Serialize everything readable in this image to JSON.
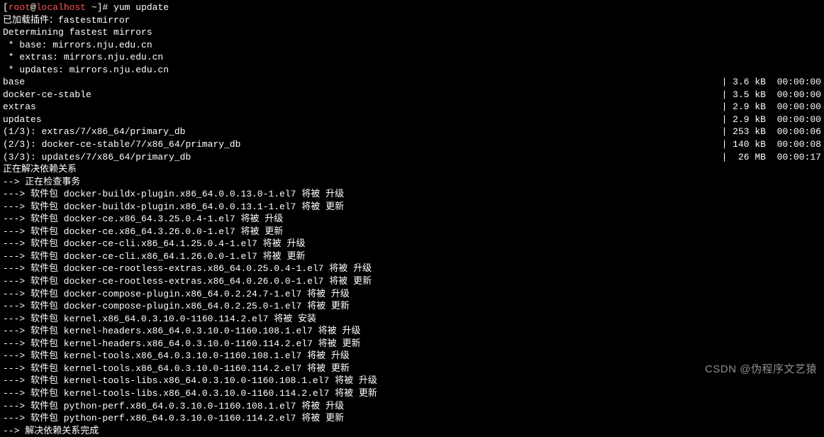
{
  "prompt": {
    "lbracket": "[",
    "user": "root",
    "at": "@",
    "host": "localhost",
    "path": " ~",
    "rbracket": "]# ",
    "command": "yum update"
  },
  "header_lines": [
    "已加载插件：fastestmirror",
    "Determining fastest mirrors",
    " * base: mirrors.nju.edu.cn",
    " * extras: mirrors.nju.edu.cn",
    " * updates: mirrors.nju.edu.cn"
  ],
  "repo_rows": [
    {
      "left": "base",
      "right": "| 3.6 kB  00:00:00"
    },
    {
      "left": "docker-ce-stable",
      "right": "| 3.5 kB  00:00:00"
    },
    {
      "left": "extras",
      "right": "| 2.9 kB  00:00:00"
    },
    {
      "left": "updates",
      "right": "| 2.9 kB  00:00:00"
    },
    {
      "left": "(1/3): extras/7/x86_64/primary_db",
      "right": "| 253 kB  00:00:06"
    },
    {
      "left": "(2/3): docker-ce-stable/7/x86_64/primary_db",
      "right": "| 140 kB  00:00:08"
    },
    {
      "left": "(3/3): updates/7/x86_64/primary_db",
      "right": "|  26 MB  00:00:17"
    }
  ],
  "resolve_lines": [
    "正在解决依赖关系",
    "--> 正在检查事务",
    "---> 软件包 docker-buildx-plugin.x86_64.0.0.13.0-1.el7 将被 升级",
    "---> 软件包 docker-buildx-plugin.x86_64.0.0.13.1-1.el7 将被 更新",
    "---> 软件包 docker-ce.x86_64.3.25.0.4-1.el7 将被 升级",
    "---> 软件包 docker-ce.x86_64.3.26.0.0-1.el7 将被 更新",
    "---> 软件包 docker-ce-cli.x86_64.1.25.0.4-1.el7 将被 升级",
    "---> 软件包 docker-ce-cli.x86_64.1.26.0.0-1.el7 将被 更新",
    "---> 软件包 docker-ce-rootless-extras.x86_64.0.25.0.4-1.el7 将被 升级",
    "---> 软件包 docker-ce-rootless-extras.x86_64.0.26.0.0-1.el7 将被 更新",
    "---> 软件包 docker-compose-plugin.x86_64.0.2.24.7-1.el7 将被 升级",
    "---> 软件包 docker-compose-plugin.x86_64.0.2.25.0-1.el7 将被 更新",
    "---> 软件包 kernel.x86_64.0.3.10.0-1160.114.2.el7 将被 安装",
    "---> 软件包 kernel-headers.x86_64.0.3.10.0-1160.108.1.el7 将被 升级",
    "---> 软件包 kernel-headers.x86_64.0.3.10.0-1160.114.2.el7 将被 更新",
    "---> 软件包 kernel-tools.x86_64.0.3.10.0-1160.108.1.el7 将被 升级",
    "---> 软件包 kernel-tools.x86_64.0.3.10.0-1160.114.2.el7 将被 更新",
    "---> 软件包 kernel-tools-libs.x86_64.0.3.10.0-1160.108.1.el7 将被 升级",
    "---> 软件包 kernel-tools-libs.x86_64.0.3.10.0-1160.114.2.el7 将被 更新",
    "---> 软件包 python-perf.x86_64.0.3.10.0-1160.108.1.el7 将被 升级",
    "---> 软件包 python-perf.x86_64.0.3.10.0-1160.114.2.el7 将被 更新",
    "--> 解决依赖关系完成"
  ],
  "watermark": "CSDN @伪程序文艺猿"
}
